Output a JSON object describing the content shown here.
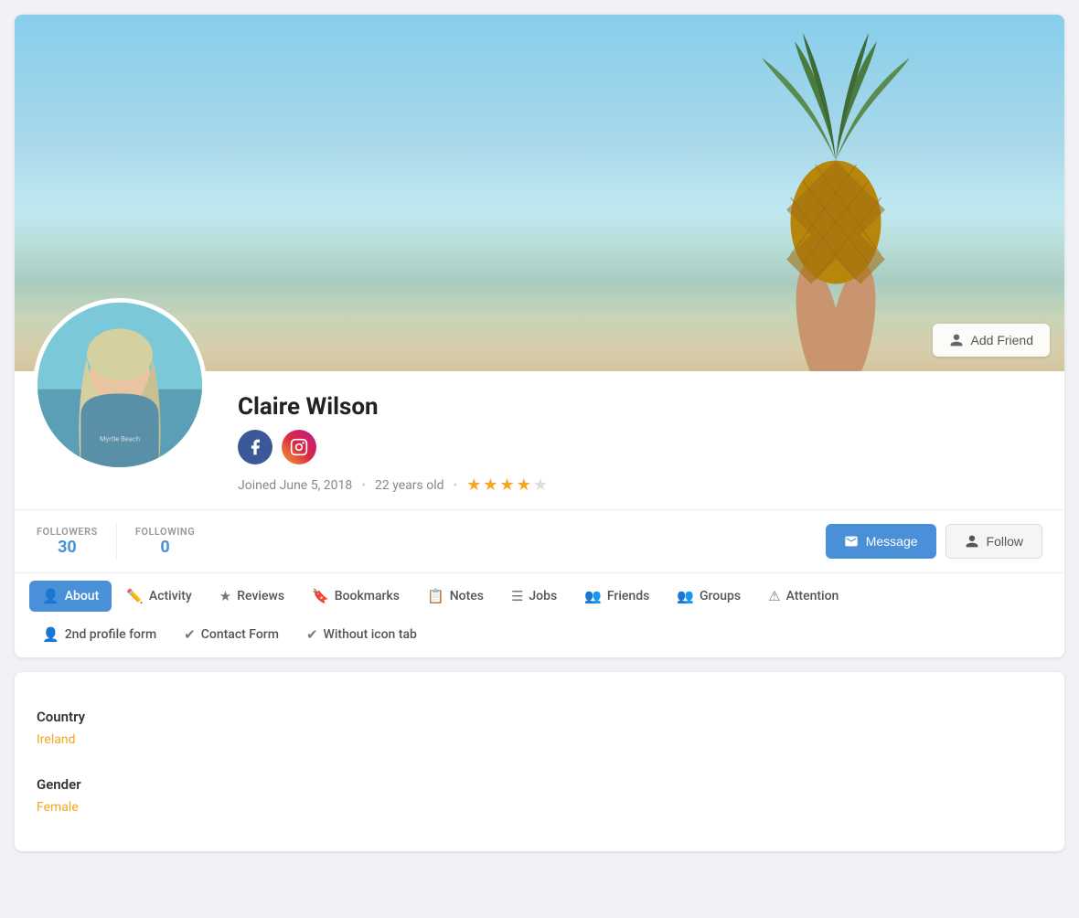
{
  "profile": {
    "name": "Claire Wilson",
    "joined": "Joined June 5, 2018",
    "age": "22 years old",
    "rating": 3.5,
    "followers_label": "FOLLOWERS",
    "followers_count": "30",
    "following_label": "FOLLOWING",
    "following_count": "0"
  },
  "buttons": {
    "add_friend": "Add Friend",
    "message": "Message",
    "follow": "Follow"
  },
  "tabs": [
    {
      "id": "about",
      "label": "About",
      "icon": "👤",
      "active": true
    },
    {
      "id": "activity",
      "label": "Activity",
      "icon": "✏️",
      "active": false
    },
    {
      "id": "reviews",
      "label": "Reviews",
      "icon": "★",
      "active": false
    },
    {
      "id": "bookmarks",
      "label": "Bookmarks",
      "icon": "🔖",
      "active": false
    },
    {
      "id": "notes",
      "label": "Notes",
      "icon": "📋",
      "active": false
    },
    {
      "id": "jobs",
      "label": "Jobs",
      "icon": "☰",
      "active": false
    },
    {
      "id": "friends",
      "label": "Friends",
      "icon": "👥",
      "active": false
    },
    {
      "id": "groups",
      "label": "Groups",
      "icon": "👥",
      "active": false
    },
    {
      "id": "attention",
      "label": "Attention",
      "icon": "⚠",
      "active": false
    },
    {
      "id": "2nd-profile-form",
      "label": "2nd profile form",
      "icon": "👤",
      "active": false
    },
    {
      "id": "contact-form",
      "label": "Contact Form",
      "icon": "✔",
      "active": false
    },
    {
      "id": "without-icon-tab",
      "label": "Without icon tab",
      "icon": "✔",
      "active": false
    }
  ],
  "content": {
    "fields": [
      {
        "label": "Country",
        "value": "Ireland"
      },
      {
        "label": "Gender",
        "value": "Female"
      }
    ]
  }
}
